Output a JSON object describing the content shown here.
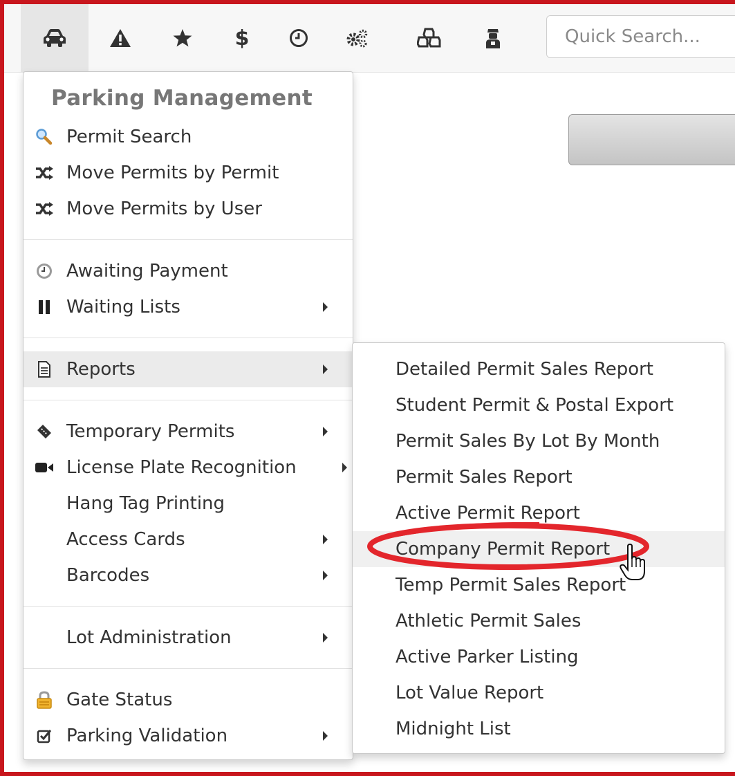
{
  "toolbar": {
    "icons": [
      "car-icon",
      "warning-icon",
      "star-icon",
      "dollar-icon",
      "clock-icon",
      "gears-icon",
      "cubes-icon",
      "officer-icon"
    ],
    "dollar_glyph": "$",
    "search_placeholder": "Quick Search..."
  },
  "menu": {
    "title": "Parking Management",
    "items": [
      {
        "label": "Permit Search",
        "icon": "magnifier-icon"
      },
      {
        "label": "Move Permits by Permit",
        "icon": "shuffle-icon"
      },
      {
        "label": "Move Permits by User",
        "icon": "shuffle-icon"
      },
      {
        "label": "Awaiting Payment",
        "icon": "clock-icon"
      },
      {
        "label": "Waiting Lists",
        "icon": "pause-icon",
        "submenu": true
      },
      {
        "label": "Reports",
        "icon": "document-icon",
        "submenu": true,
        "highlighted": true
      },
      {
        "label": "Temporary Permits",
        "icon": "ticket-icon",
        "submenu": true
      },
      {
        "label": "License Plate Recognition",
        "icon": "video-camera-icon",
        "submenu": true
      },
      {
        "label": "Hang Tag Printing"
      },
      {
        "label": "Access Cards",
        "submenu": true
      },
      {
        "label": "Barcodes",
        "submenu": true
      },
      {
        "label": "Lot Administration",
        "submenu": true
      },
      {
        "label": "Gate Status",
        "icon": "lock-icon"
      },
      {
        "label": "Parking Validation",
        "icon": "checkbox-icon",
        "submenu": true
      }
    ]
  },
  "reports_submenu": {
    "items": [
      "Detailed Permit Sales Report",
      "Student Permit & Postal Export",
      "Permit Sales By Lot By Month",
      "Permit Sales Report",
      "Active Permit Report",
      "Company Permit Report",
      "Temp Permit Sales Report",
      "Athletic Permit Sales",
      "Active Parker Listing",
      "Lot Value Report",
      "Midnight List"
    ],
    "highlighted": "Company Permit Report"
  },
  "colors": {
    "frame": "#c8161d",
    "annotation": "#e3262c",
    "highlight": "#ebebeb"
  }
}
